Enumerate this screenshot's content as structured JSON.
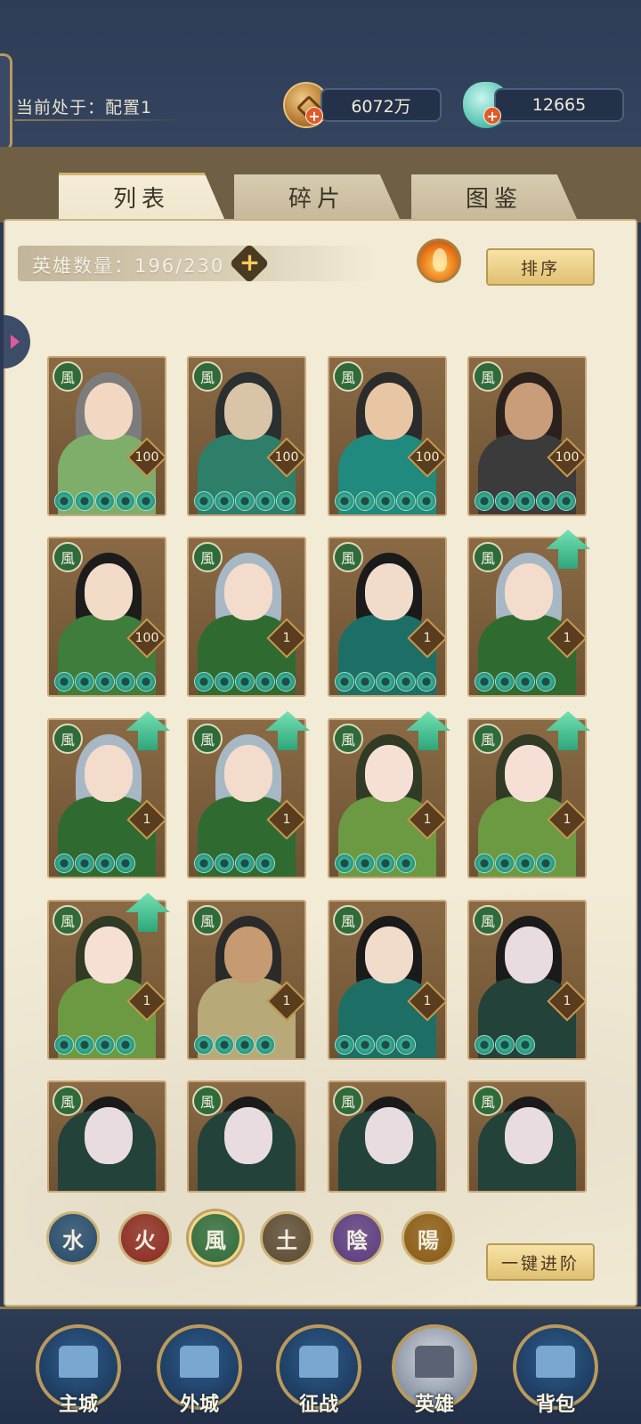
{
  "header": {
    "config_label": "当前处于：配置1",
    "coins": "6072万",
    "gems": "12665",
    "coin_icon": "copper-coin-icon",
    "gem_icon": "jade-shell-icon"
  },
  "tabs": [
    {
      "label": "列表",
      "active": true
    },
    {
      "label": "碎片",
      "active": false
    },
    {
      "label": "图鉴",
      "active": false
    }
  ],
  "hero_count": {
    "label": "英雄数量：196/230",
    "current": 196,
    "max": 230
  },
  "sort_button": "排序",
  "advance_button": "一键进阶",
  "element_glyph": "風",
  "heroes": [
    {
      "level": "100",
      "stars": 5,
      "upgrade": false
    },
    {
      "level": "100",
      "stars": 5,
      "upgrade": false
    },
    {
      "level": "100",
      "stars": 5,
      "upgrade": false
    },
    {
      "level": "100",
      "stars": 5,
      "upgrade": false
    },
    {
      "level": "100",
      "stars": 5,
      "upgrade": false
    },
    {
      "level": "1",
      "stars": 5,
      "upgrade": false
    },
    {
      "level": "1",
      "stars": 5,
      "upgrade": false
    },
    {
      "level": "1",
      "stars": 4,
      "upgrade": true
    },
    {
      "level": "1",
      "stars": 4,
      "upgrade": true
    },
    {
      "level": "1",
      "stars": 4,
      "upgrade": true
    },
    {
      "level": "1",
      "stars": 4,
      "upgrade": true
    },
    {
      "level": "1",
      "stars": 4,
      "upgrade": true
    },
    {
      "level": "1",
      "stars": 4,
      "upgrade": true
    },
    {
      "level": "1",
      "stars": 4,
      "upgrade": false
    },
    {
      "level": "1",
      "stars": 4,
      "upgrade": false
    },
    {
      "level": "1",
      "stars": 3,
      "upgrade": false
    },
    {
      "level": "",
      "stars": 0,
      "upgrade": false
    },
    {
      "level": "",
      "stars": 0,
      "upgrade": false
    },
    {
      "level": "",
      "stars": 0,
      "upgrade": false
    },
    {
      "level": "",
      "stars": 0,
      "upgrade": false
    }
  ],
  "filters": [
    {
      "glyph": "水",
      "color": "#244a6b",
      "active": false
    },
    {
      "glyph": "火",
      "color": "#8c2a21",
      "active": false
    },
    {
      "glyph": "風",
      "color": "#2f6b3a",
      "active": true
    },
    {
      "glyph": "土",
      "color": "#5b4a33",
      "active": false
    },
    {
      "glyph": "陰",
      "color": "#5a3a80",
      "active": false
    },
    {
      "glyph": "陽",
      "color": "#8a5a12",
      "active": false
    }
  ],
  "bottom_nav": [
    {
      "label": "主城",
      "icon": "main-city-icon"
    },
    {
      "label": "外城",
      "icon": "outer-city-icon"
    },
    {
      "label": "征战",
      "icon": "campaign-icon"
    },
    {
      "label": "英雄",
      "icon": "hero-icon",
      "active": true
    },
    {
      "label": "背包",
      "icon": "bag-icon"
    }
  ]
}
